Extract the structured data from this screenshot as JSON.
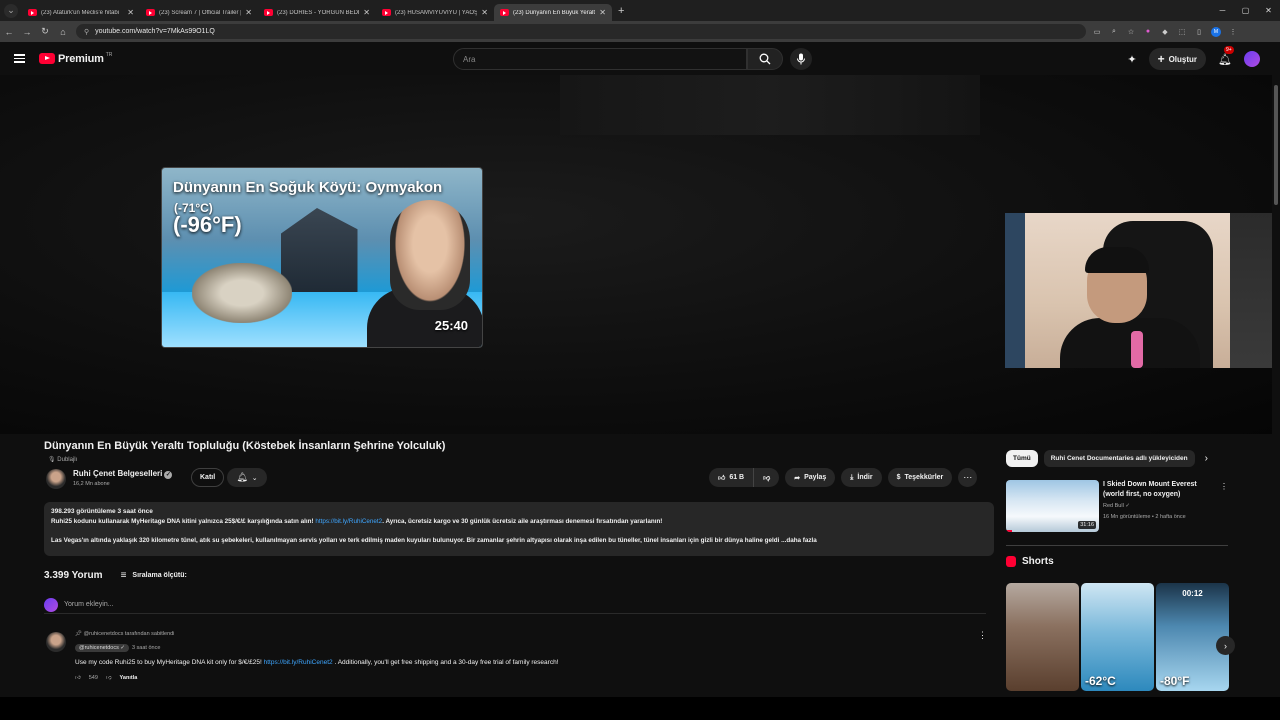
{
  "browser": {
    "tabs": [
      {
        "title": "(23) Atatürk'ün Meclis'e hitabı",
        "active": false
      },
      {
        "title": "(23) Scream 7 | Official Trailer |",
        "active": false
      },
      {
        "title": "(23) DORİES - YORGUN BEDEN",
        "active": false
      },
      {
        "title": "(23) HUSAMVIYUVIYU | YAOŞI",
        "active": false
      },
      {
        "title": "(23) Dünyanın En Büyük Yeraltı",
        "active": true
      }
    ],
    "url": "youtube.com/watch?v=7MkAs99O1LQ",
    "profile": "M"
  },
  "header": {
    "logo_text": "Premium",
    "region": "TR",
    "search_placeholder": "Ara",
    "create_label": "Oluştur",
    "notif_count": "9+"
  },
  "player": {
    "thumb_title": "Dünyanın En Soğuk Köyü: Oymyakon",
    "temp_c": "(-71°C)",
    "temp_f": "(-96°F)",
    "duration": "25:40"
  },
  "video": {
    "title": "Dünyanın En Büyük Yeraltı Topluluğu (Köstebek İnsanların Şehrine Yolculuk)",
    "dubbed": "Dublajlı",
    "channel": "Ruhi Çenet Belgeselleri",
    "subscribers": "16,2 Mn abone",
    "join": "Katıl",
    "likes": "61 B",
    "share": "Paylaş",
    "download": "İndir",
    "thanks": "Teşekkürler"
  },
  "description": {
    "stats": "398.293 görüntüleme  3 saat önce",
    "line1_pre": "Ruhi25 kodunu kullanarak MyHeritage DNA kitini yalnızca 25$/€/£ karşılığında satın alın!",
    "line1_link": "https://bit.ly/RuhiCenet2",
    "line1_post": ". Ayrıca, ücretsiz kargo ve 30 günlük ücretsiz aile araştırması denemesi fırsatından yararlanın!",
    "line2": "Las Vegas'ın altında yaklaşık 320 kilometre tünel, atık su şebekeleri, kullanılmayan servis yolları ve terk edilmiş maden kuyuları bulunuyor. Bir zamanlar şehrin altyapısı olarak inşa edilen bu tüneller, tünel insanları için gizli bir dünya haline geldi",
    "more": "...daha fazla"
  },
  "comments": {
    "count": "3.399 Yorum",
    "sort": "Sıralama ölçütü:",
    "add_placeholder": "Yorum ekleyin...",
    "pinned": {
      "pin_label": "@ruhicenetdocs tarafından sabitlendi",
      "author": "@ruhicenetdocs",
      "time": "3 saat önce",
      "text_pre": "Use my code Ruhi25 to buy MyHeritage DNA kit only for $/€/£25!",
      "text_link": "https://bit.ly/RuhiCenet2",
      "text_post": ". Additionally, you'll get free shipping and a 30-day free trial of family research!",
      "likes": "549",
      "reply": "Yanıtla"
    }
  },
  "sidebar": {
    "chips": [
      "Tümü",
      "Ruhi Cenet Documentaries adlı yükleyiciden"
    ],
    "recommended": {
      "title": "I Skied Down Mount Everest (world first, no oxygen)",
      "channel": "Red Bull",
      "meta": "16 Mn görüntüleme • 2 hafta önce",
      "duration": "31:16"
    },
    "shorts_title": "Shorts",
    "shorts": [
      {
        "caption": ""
      },
      {
        "caption": "-62°C"
      },
      {
        "caption": "-80°F",
        "top": "00:12"
      }
    ]
  },
  "colors": {
    "accent": "#ff0033",
    "link": "#3ea6ff",
    "bg": "#0f0f0f"
  }
}
